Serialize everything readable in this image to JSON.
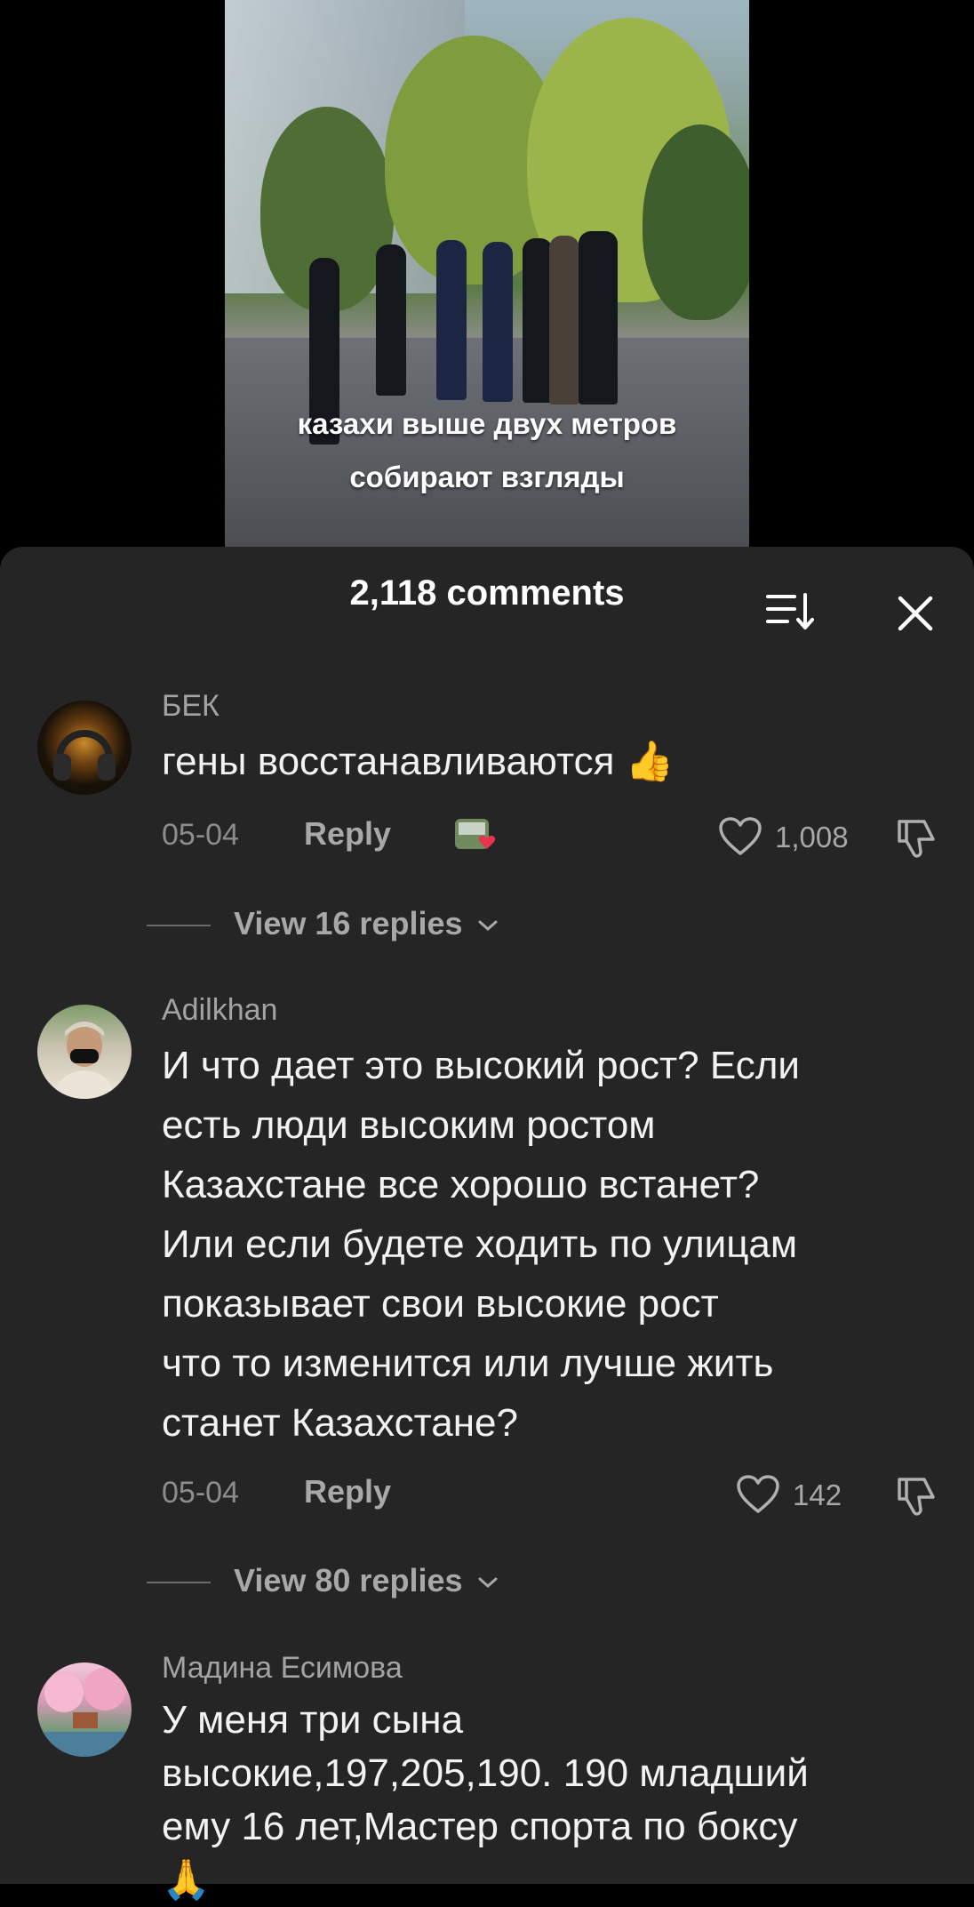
{
  "video": {
    "caption_line1": "казахи выше двух метров",
    "caption_line2": "собирают взгляды"
  },
  "sheet": {
    "title": "2,118 comments",
    "sort_icon": "sort-icon",
    "close_icon": "close-icon"
  },
  "comments": [
    {
      "username": "БЕК",
      "text": "гены восстанавливаются 👍",
      "date": "05-04",
      "reply_label": "Reply",
      "likes": "1,008",
      "view_replies": "View 16 replies"
    },
    {
      "username": "Adilkhan",
      "text": "И что дает это высокий рост? Если\nесть люди высоким ростом\nКазахстане все хорошо встанет?\nИли если будете ходить по улицам\nпоказывает свои высокие рост\nчто то изменится или лучше жить\nстанет Казахстане?",
      "date": "05-04",
      "reply_label": "Reply",
      "likes": "142",
      "view_replies": "View 80 replies"
    },
    {
      "username": "Мадина Есимова",
      "text": "У меня три сына\nвысокие,197,205,190. 190 младший\nему 16 лет,Мастер спорта по боксу\n🙏"
    }
  ],
  "colors": {
    "sheet_bg": "#252525",
    "username": "#a3a3a3",
    "meta": "#8d8d8d"
  }
}
